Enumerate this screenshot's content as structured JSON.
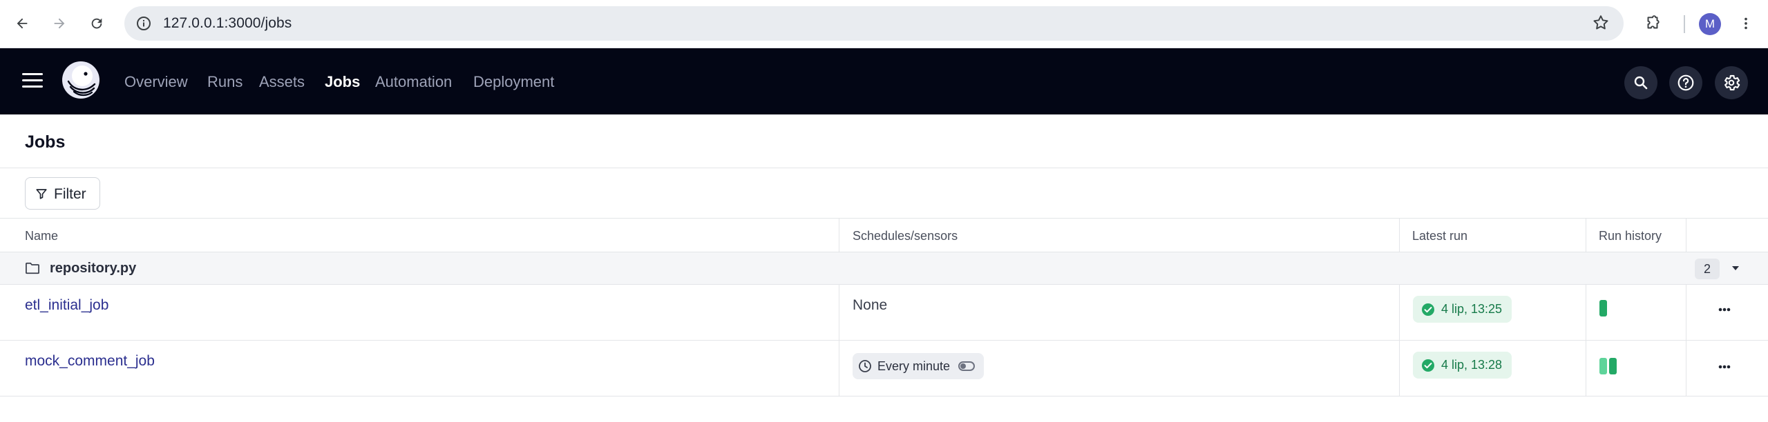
{
  "browser": {
    "url": "127.0.0.1:3000/jobs",
    "profile_initial": "M"
  },
  "nav": {
    "items": [
      {
        "label": "Overview",
        "active": false
      },
      {
        "label": "Runs",
        "active": false
      },
      {
        "label": "Assets",
        "active": false
      },
      {
        "label": "Jobs",
        "active": true
      },
      {
        "label": "Automation",
        "active": false
      },
      {
        "label": "Deployment",
        "active": false
      }
    ],
    "icons": [
      "search-icon",
      "help-icon",
      "settings-icon"
    ]
  },
  "page": {
    "title": "Jobs",
    "filter_label": "Filter"
  },
  "table": {
    "columns": [
      "Name",
      "Schedules/sensors",
      "Latest run",
      "Run history"
    ],
    "group": {
      "name": "repository.py",
      "count": "2"
    },
    "rows": [
      {
        "name": "etl_initial_job",
        "schedule": "None",
        "latest_run": "4 lip, 13:25",
        "latest_run_status": "success",
        "run_history": [
          "success"
        ]
      },
      {
        "name": "mock_comment_job",
        "schedule": "Every minute",
        "schedule_enabled": false,
        "latest_run": "4 lip, 13:28",
        "latest_run_status": "success",
        "run_history": [
          "success",
          "success"
        ]
      }
    ]
  },
  "colors": {
    "nav_bg": "#030615",
    "link": "#2b2f8f",
    "success": "#23a966",
    "success_bg": "#e5f5ec"
  }
}
